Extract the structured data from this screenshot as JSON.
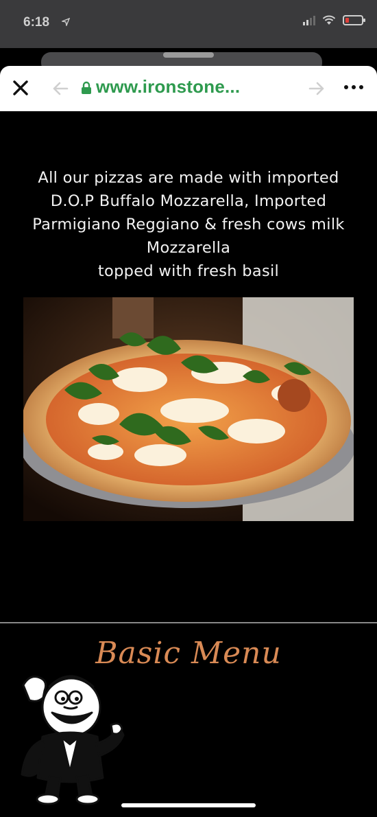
{
  "status_bar": {
    "time": "6:18",
    "location_icon": "location-arrow-icon",
    "battery_color": "#e0403a"
  },
  "browser": {
    "url": "www.ironstone...",
    "close_icon": "close-icon",
    "back_icon": "back-arrow-icon",
    "lock_icon": "lock-icon",
    "forward_icon": "forward-arrow-icon",
    "more_icon": "more-dots-icon",
    "url_color": "#2e9a4e"
  },
  "page": {
    "intro_lines": [
      "All our pizzas are made with imported",
      "D.O.P Buffalo Mozzarella, Imported",
      "Parmigiano Reggiano & fresh cows milk",
      "Mozzarella",
      "topped with fresh basil"
    ],
    "menu_title": "Basic Menu",
    "accent_color": "#d98a55"
  }
}
